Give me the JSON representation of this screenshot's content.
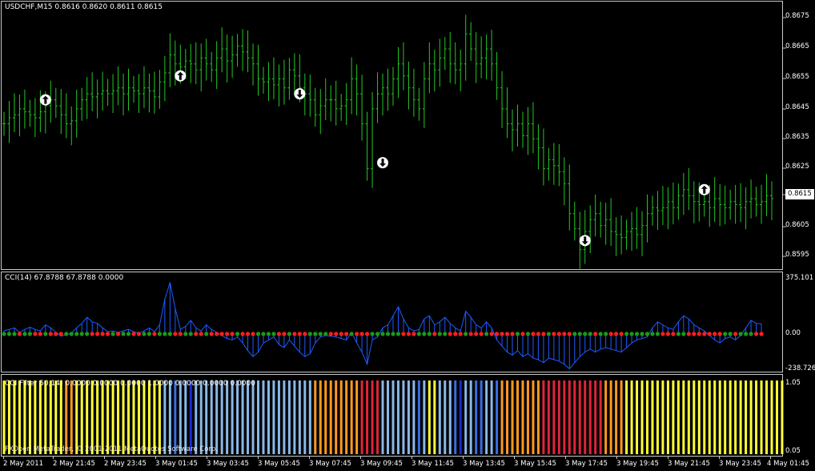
{
  "chart_header": "USDCHF,M15  0.8616 0.8620 0.8611 0.8615",
  "cci_header": "CCI(14) 67.8788 67.8788 0.0000",
  "filter_header": "CCI Filter 50,14) 0.0000 0.0000 0.0000 1.0000 0.0000 0.0000 0.0000",
  "copyright": "FXOpen MetaTrader, © 2001-2011 MetaQuotes Software Corp.",
  "price_axis": [
    "0.8675",
    "0.8665",
    "0.8655",
    "0.8645",
    "0.8635",
    "0.8625",
    "0.8615",
    "0.8605",
    "0.8595"
  ],
  "current_price": "0.8615",
  "cci_axis": [
    "375.101",
    "0.00",
    "-238.726"
  ],
  "filter_axis": [
    "1.05",
    "0.05"
  ],
  "time_axis": [
    "2 May 2011",
    "2 May 21:45",
    "2 May 23:45",
    "3 May 01:45",
    "3 May 03:45",
    "3 May 05:45",
    "3 May 07:45",
    "3 May 09:45",
    "3 May 11:45",
    "3 May 13:45",
    "3 May 15:45",
    "3 May 17:45",
    "3 May 19:45",
    "3 May 21:45",
    "3 May 23:45",
    "4 May 01:45"
  ],
  "colors": {
    "bars": "#22c822",
    "cci_line": "#1e5aff",
    "dot_up": "#1a9a1a",
    "dot_down": "#ff1e1e",
    "hist_yellow": "#ffff33",
    "hist_orange": "#ff9a1e",
    "hist_red": "#e0243a",
    "hist_light_blue": "#8ab8e8",
    "hist_blue": "#3a6ee0",
    "hist_dark_blue": "#1a2ad0"
  },
  "chart_data": {
    "type": "ohlc",
    "symbol": "USDCHF",
    "timeframe": "M15",
    "ylim": [
      0.8592,
      0.868
    ],
    "close": [
      0.864,
      0.8642,
      0.8643,
      0.8645,
      0.8644,
      0.8643,
      0.8642,
      0.8644,
      0.8646,
      0.8648,
      0.8646,
      0.8643,
      0.864,
      0.8641,
      0.8645,
      0.8648,
      0.865,
      0.8649,
      0.865,
      0.8651,
      0.865,
      0.8651,
      0.8652,
      0.865,
      0.8652,
      0.8651,
      0.865,
      0.8652,
      0.8651,
      0.8649,
      0.8654,
      0.8657,
      0.8663,
      0.866,
      0.8659,
      0.8661,
      0.866,
      0.8658,
      0.8662,
      0.866,
      0.8658,
      0.8662,
      0.8665,
      0.8661,
      0.8663,
      0.8666,
      0.8664,
      0.8662,
      0.866,
      0.8655,
      0.8654,
      0.8655,
      0.8653,
      0.8655,
      0.8652,
      0.8658,
      0.8656,
      0.8652,
      0.865,
      0.8648,
      0.8643,
      0.8646,
      0.8648,
      0.8648,
      0.8645,
      0.8646,
      0.8648,
      0.8655,
      0.865,
      0.864,
      0.8625,
      0.8645,
      0.865,
      0.8652,
      0.865,
      0.8655,
      0.866,
      0.8656,
      0.8652,
      0.8648,
      0.8645,
      0.8655,
      0.866,
      0.8658,
      0.8662,
      0.8665,
      0.866,
      0.8658,
      0.866,
      0.867,
      0.8665,
      0.866,
      0.8662,
      0.8665,
      0.866,
      0.8652,
      0.8645,
      0.864,
      0.8638,
      0.864,
      0.8636,
      0.864,
      0.8635,
      0.8632,
      0.8625,
      0.8628,
      0.8626,
      0.8624,
      0.862,
      0.861,
      0.8605,
      0.8598,
      0.8604,
      0.8608,
      0.861,
      0.8606,
      0.8608,
      0.8604,
      0.8603,
      0.8602,
      0.8604,
      0.8605,
      0.8603,
      0.8606,
      0.861,
      0.8612,
      0.8611,
      0.8612,
      0.8614,
      0.8612,
      0.8616,
      0.8618,
      0.8616,
      0.8614,
      0.8613,
      0.8614,
      0.8612,
      0.8615,
      0.8613,
      0.8612,
      0.8614,
      0.8613,
      0.8612,
      0.8614,
      0.8615,
      0.8613,
      0.8614,
      0.8616,
      0.8615
    ],
    "arrows": [
      {
        "index": 8,
        "dir": "up",
        "price": 0.8648
      },
      {
        "index": 34,
        "dir": "up",
        "price": 0.8656
      },
      {
        "index": 57,
        "dir": "down",
        "price": 0.865
      },
      {
        "index": 73,
        "dir": "down",
        "price": 0.8627
      },
      {
        "index": 112,
        "dir": "down",
        "price": 0.8601
      },
      {
        "index": 135,
        "dir": "up",
        "price": 0.8618
      }
    ],
    "cci": {
      "ylim": [
        -238.726,
        375.101
      ],
      "values": [
        20,
        30,
        40,
        10,
        30,
        45,
        30,
        20,
        60,
        40,
        10,
        -15,
        -5,
        5,
        40,
        70,
        110,
        80,
        70,
        40,
        15,
        20,
        10,
        20,
        30,
        15,
        5,
        20,
        40,
        15,
        60,
        230,
        340,
        170,
        30,
        50,
        90,
        40,
        20,
        60,
        30,
        10,
        -10,
        -30,
        -40,
        -20,
        -60,
        -110,
        -150,
        -120,
        -60,
        -40,
        -20,
        -70,
        -90,
        -40,
        -80,
        -120,
        -150,
        -130,
        -60,
        -20,
        -10,
        -15,
        -20,
        -30,
        -40,
        10,
        -60,
        -120,
        -200,
        -40,
        -20,
        40,
        60,
        120,
        180,
        100,
        40,
        20,
        30,
        100,
        120,
        60,
        80,
        110,
        70,
        40,
        20,
        150,
        110,
        60,
        40,
        80,
        40,
        -40,
        -80,
        -120,
        -140,
        -110,
        -150,
        -130,
        -160,
        -170,
        -190,
        -160,
        -170,
        -180,
        -200,
        -230,
        -190,
        -150,
        -120,
        -100,
        -120,
        -100,
        -90,
        -100,
        -110,
        -120,
        -90,
        -60,
        -40,
        -30,
        -20,
        40,
        80,
        60,
        40,
        30,
        80,
        120,
        100,
        60,
        40,
        20,
        -10,
        -40,
        -60,
        -30,
        -20,
        -40,
        -10,
        40,
        90,
        70,
        67.8788
      ]
    },
    "filter": {
      "ylim": [
        0,
        1.05
      ],
      "states": [
        "y",
        "y",
        "y",
        "y",
        "y",
        "y",
        "y",
        "y",
        "y",
        "y",
        "y",
        "y",
        "o",
        "o",
        "y",
        "y",
        "y",
        "y",
        "y",
        "y",
        "y",
        "y",
        "y",
        "y",
        "y",
        "y",
        "y",
        "y",
        "y",
        "y",
        "y",
        "lb",
        "lb",
        "b",
        "lb",
        "lb",
        "db",
        "lb",
        "lb",
        "lb",
        "lb",
        "lb",
        "lb",
        "lb",
        "lb",
        "lb",
        "lb",
        "lb",
        "lb",
        "lb",
        "lb",
        "lb",
        "lb",
        "lb",
        "lb",
        "lb",
        "lb",
        "lb",
        "lb",
        "lb",
        "o",
        "o",
        "o",
        "o",
        "o",
        "o",
        "o",
        "o",
        "o",
        "r",
        "r",
        "r",
        "r",
        "lb",
        "lb",
        "lb",
        "lb",
        "lb",
        "lb",
        "lb",
        "b",
        "lb",
        "y",
        "y",
        "lb",
        "lb",
        "lb",
        "b",
        "db",
        "lb",
        "lb",
        "b",
        "b",
        "lb",
        "lb",
        "b",
        "o",
        "o",
        "o",
        "o",
        "o",
        "o",
        "o",
        "o",
        "r",
        "r",
        "r",
        "r",
        "r",
        "r",
        "r",
        "r",
        "r",
        "r",
        "r",
        "r",
        "o",
        "o",
        "o",
        "o",
        "y",
        "y",
        "y",
        "y",
        "y",
        "y",
        "y",
        "y",
        "y",
        "y",
        "y",
        "y",
        "y",
        "y",
        "y",
        "y",
        "y",
        "y",
        "y",
        "y",
        "y",
        "y",
        "y",
        "y",
        "y",
        "y",
        "y",
        "y",
        "y",
        "y",
        "y"
      ]
    }
  }
}
